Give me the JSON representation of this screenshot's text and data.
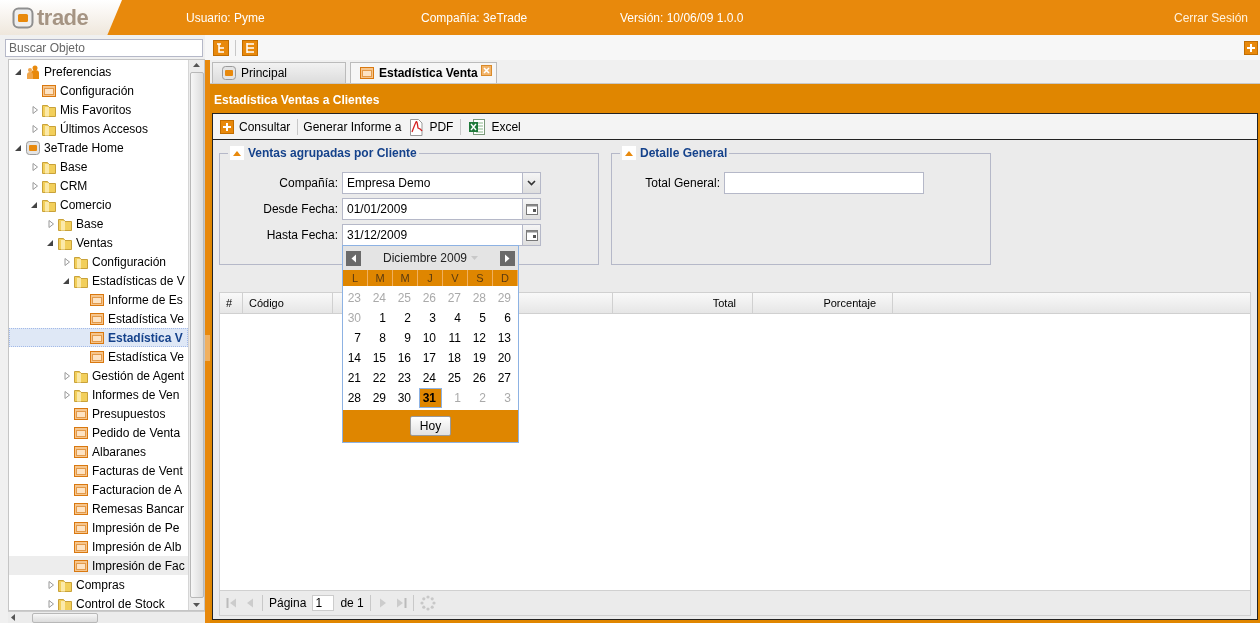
{
  "header": {
    "logo": "trade",
    "user": "Usuario: Pyme",
    "company": "Compañía: 3eTrade",
    "version": "Versión: 10/06/09 1.0.0",
    "logout": "Cerrar Sesión"
  },
  "sidebar": {
    "search": {
      "placeholder": "Buscar Objeto"
    },
    "tree": [
      {
        "label": "Preferencias",
        "kind": "user",
        "expanded": true,
        "selected": false,
        "children": [
          {
            "label": "Configuración",
            "kind": "page",
            "selected": false
          },
          {
            "label": "Mis Favoritos",
            "kind": "folder",
            "expanded": false,
            "selected": false
          },
          {
            "label": "Últimos Accesos",
            "kind": "folder",
            "expanded": false,
            "selected": false
          }
        ]
      },
      {
        "label": "3eTrade Home",
        "kind": "home",
        "expanded": true,
        "selected": false,
        "children": [
          {
            "label": "Base",
            "kind": "folder",
            "expanded": false,
            "selected": false
          },
          {
            "label": "CRM",
            "kind": "folder",
            "expanded": false,
            "selected": false
          },
          {
            "label": "Comercio",
            "kind": "folder",
            "expanded": true,
            "selected": false,
            "children": [
              {
                "label": "Base",
                "kind": "folder",
                "expanded": false,
                "selected": false
              },
              {
                "label": "Ventas",
                "kind": "folder",
                "expanded": true,
                "selected": false,
                "children": [
                  {
                    "label": "Configuración",
                    "kind": "folder",
                    "expanded": false,
                    "selected": false
                  },
                  {
                    "label": "Estadísticas de V",
                    "kind": "folder",
                    "expanded": true,
                    "selected": false,
                    "children": [
                      {
                        "label": "Informe de Es",
                        "kind": "page",
                        "selected": false
                      },
                      {
                        "label": "Estadística Ve",
                        "kind": "page",
                        "selected": false
                      },
                      {
                        "label": "Estadística V",
                        "kind": "page",
                        "selected": true
                      },
                      {
                        "label": "Estadística Ve",
                        "kind": "page",
                        "selected": false
                      }
                    ]
                  },
                  {
                    "label": "Gestión de Agent",
                    "kind": "folder",
                    "expanded": false,
                    "selected": false
                  },
                  {
                    "label": "Informes de Ven",
                    "kind": "folder",
                    "expanded": false,
                    "selected": false
                  },
                  {
                    "label": "Presupuestos",
                    "kind": "page",
                    "selected": false
                  },
                  {
                    "label": "Pedido de Venta",
                    "kind": "page",
                    "selected": false
                  },
                  {
                    "label": "Albaranes",
                    "kind": "page",
                    "selected": false
                  },
                  {
                    "label": "Facturas de Vent",
                    "kind": "page",
                    "selected": false
                  },
                  {
                    "label": "Facturacion de A",
                    "kind": "page",
                    "selected": false
                  },
                  {
                    "label": "Remesas Bancar",
                    "kind": "page",
                    "selected": false
                  },
                  {
                    "label": "Impresión de Pe",
                    "kind": "page",
                    "selected": false
                  },
                  {
                    "label": "Impresión de Alb",
                    "kind": "page",
                    "selected": false
                  },
                  {
                    "label": "Impresión de Fac",
                    "kind": "page",
                    "selected": false,
                    "hovered": true
                  }
                ]
              },
              {
                "label": "Compras",
                "kind": "folder",
                "expanded": false,
                "selected": false
              },
              {
                "label": "Control de Stock",
                "kind": "folder",
                "expanded": false,
                "selected": false
              }
            ]
          }
        ]
      }
    ]
  },
  "tabs": [
    {
      "label": "Principal",
      "kind": "home",
      "selected": false,
      "closable": false
    },
    {
      "label": "Estadística Venta",
      "kind": "page",
      "selected": true,
      "closable": true
    }
  ],
  "panel": {
    "title": "Estadística Ventas a Clientes",
    "toolbar": [
      {
        "kind": "add",
        "label": "Consultar"
      },
      {
        "kind": "separator"
      },
      {
        "kind": "label",
        "label": "Generar Informe a"
      },
      {
        "kind": "pdf",
        "label": "PDF"
      },
      {
        "kind": "separator"
      },
      {
        "kind": "excel",
        "label": "Excel"
      }
    ],
    "fieldsets": [
      {
        "legend": "Ventas agrupadas por Cliente",
        "expanded": true,
        "fields": [
          {
            "label": "Compañía:",
            "kind": "combo",
            "value": "Empresa Demo"
          },
          {
            "label": "Desde Fecha:",
            "kind": "date",
            "value": "01/01/2009"
          },
          {
            "label": "Hasta Fecha:",
            "kind": "date",
            "value": "31/12/2009"
          }
        ]
      },
      {
        "legend": "Detalle General",
        "expanded": true,
        "fields": [
          {
            "label": "Total General:",
            "kind": "text"
          }
        ]
      }
    ],
    "grid": {
      "columns": [
        {
          "label": "#",
          "kind": "text"
        },
        {
          "label": "Código",
          "kind": "text"
        },
        {
          "label": "Total",
          "kind": "numeric"
        },
        {
          "label": "Porcentaje",
          "kind": "numeric"
        }
      ]
    },
    "pager": {
      "page_label": "Página",
      "page": "1",
      "of": "de 1"
    }
  },
  "calendar": {
    "month": "Diciembre 2009",
    "weekdays": [
      "L",
      "M",
      "M",
      "J",
      "V",
      "S",
      "D"
    ],
    "days": [
      {
        "day": "23",
        "other_month": true,
        "selected": false
      },
      {
        "day": "24",
        "other_month": true,
        "selected": false
      },
      {
        "day": "25",
        "other_month": true,
        "selected": false
      },
      {
        "day": "26",
        "other_month": true,
        "selected": false
      },
      {
        "day": "27",
        "other_month": true,
        "selected": false
      },
      {
        "day": "28",
        "other_month": true,
        "selected": false
      },
      {
        "day": "29",
        "other_month": true,
        "selected": false
      },
      {
        "day": "30",
        "other_month": true,
        "selected": false
      },
      {
        "day": "1",
        "other_month": false,
        "selected": false
      },
      {
        "day": "2",
        "other_month": false,
        "selected": false
      },
      {
        "day": "3",
        "other_month": false,
        "selected": false
      },
      {
        "day": "4",
        "other_month": false,
        "selected": false
      },
      {
        "day": "5",
        "other_month": false,
        "selected": false
      },
      {
        "day": "6",
        "other_month": false,
        "selected": false
      },
      {
        "day": "7",
        "other_month": false,
        "selected": false
      },
      {
        "day": "8",
        "other_month": false,
        "selected": false
      },
      {
        "day": "9",
        "other_month": false,
        "selected": false
      },
      {
        "day": "10",
        "other_month": false,
        "selected": false
      },
      {
        "day": "11",
        "other_month": false,
        "selected": false
      },
      {
        "day": "12",
        "other_month": false,
        "selected": false
      },
      {
        "day": "13",
        "other_month": false,
        "selected": false
      },
      {
        "day": "14",
        "other_month": false,
        "selected": false
      },
      {
        "day": "15",
        "other_month": false,
        "selected": false
      },
      {
        "day": "16",
        "other_month": false,
        "selected": false
      },
      {
        "day": "17",
        "other_month": false,
        "selected": false
      },
      {
        "day": "18",
        "other_month": false,
        "selected": false
      },
      {
        "day": "19",
        "other_month": false,
        "selected": false
      },
      {
        "day": "20",
        "other_month": false,
        "selected": false
      },
      {
        "day": "21",
        "other_month": false,
        "selected": false
      },
      {
        "day": "22",
        "other_month": false,
        "selected": false
      },
      {
        "day": "23",
        "other_month": false,
        "selected": false
      },
      {
        "day": "24",
        "other_month": false,
        "selected": false
      },
      {
        "day": "25",
        "other_month": false,
        "selected": false
      },
      {
        "day": "26",
        "other_month": false,
        "selected": false
      },
      {
        "day": "27",
        "other_month": false,
        "selected": false
      },
      {
        "day": "28",
        "other_month": false,
        "selected": false
      },
      {
        "day": "29",
        "other_month": false,
        "selected": false
      },
      {
        "day": "30",
        "other_month": false,
        "selected": false
      },
      {
        "day": "31",
        "other_month": false,
        "selected": true
      },
      {
        "day": "1",
        "other_month": true,
        "selected": false
      },
      {
        "day": "2",
        "other_month": true,
        "selected": false
      },
      {
        "day": "3",
        "other_month": true,
        "selected": false
      }
    ],
    "today_button": "Hoy"
  }
}
